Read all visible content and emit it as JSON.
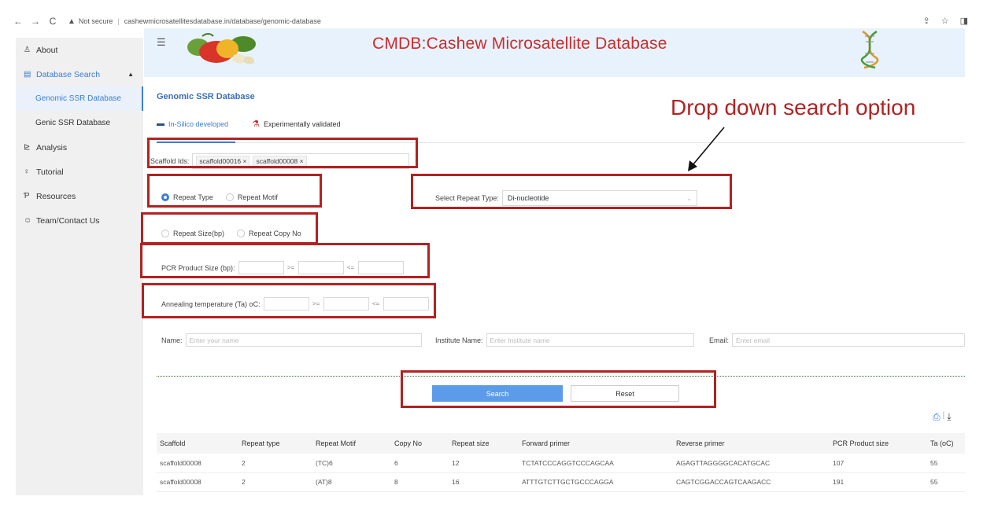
{
  "browser": {
    "back": "←",
    "forward": "→",
    "reload": "C",
    "security": "Not secure",
    "url": "cashewmicrosatellitesdatabase.in/database/genomic-database"
  },
  "sidebar": {
    "items": [
      {
        "label": "About",
        "icon": "person-icon"
      },
      {
        "label": "Database Search",
        "icon": "database-icon"
      },
      {
        "label": "Genomic SSR Database"
      },
      {
        "label": "Genic SSR Database"
      },
      {
        "label": "Analysis",
        "icon": "chart-icon"
      },
      {
        "label": "Tutorial",
        "icon": "bulb-icon"
      },
      {
        "label": "Resources",
        "icon": "resources-icon"
      },
      {
        "label": "Team/Contact Us",
        "icon": "contact-icon"
      }
    ]
  },
  "header": {
    "title": "CMDB:Cashew Microsatellite Database"
  },
  "page": {
    "title": "Genomic SSR Database",
    "tabs": [
      {
        "label": "In-Silico developed"
      },
      {
        "label": "Experimentally validated"
      }
    ]
  },
  "form": {
    "scaffold_label": "Scaffold Ids:",
    "scaffold_tags": [
      "scaffold00016 ×",
      "scaffold00008 ×"
    ],
    "repeat_type_label": "Repeat Type",
    "repeat_motif_label": "Repeat Motif",
    "select_repeat_label": "Select Repeat Type:",
    "select_repeat_value": "Di-nucleotide",
    "repeat_size_label": "Repeat Size(bp)",
    "repeat_copy_label": "Repeat Copy No",
    "pcr_label": "PCR Product Size (bp):",
    "ta_label": "Annealing temperature (Ta) oC:",
    "op_gte": ">=",
    "op_lte": "<=",
    "name_label": "Name:",
    "name_placeholder": "Enter your name",
    "institute_label": "Institute Name:",
    "institute_placeholder": "Enter Institute name",
    "email_label": "Email:",
    "email_placeholder": "Enter email",
    "search_button": "Search",
    "reset_button": "Reset"
  },
  "table": {
    "headers": [
      "Scaffold",
      "Repeat type",
      "Repeat Motif",
      "Copy No",
      "Repeat size",
      "Forward primer",
      "Reverse primer",
      "PCR Product size",
      "Ta (oC)"
    ],
    "rows": [
      [
        "scaffold00008",
        "2",
        "(TC)6",
        "6",
        "12",
        "TCTATCCCAGGTCCCAGCAA",
        "AGAGTTAGGGGCACATGCAC",
        "107",
        "55"
      ],
      [
        "scaffold00008",
        "2",
        "(AT)8",
        "8",
        "16",
        "ATTTGTCTTGCTGCCCAGGA",
        "CAGTCGGACCAGTCAAGACC",
        "191",
        "55"
      ]
    ]
  },
  "annotation": {
    "text": "Drop down search option"
  },
  "colors": {
    "accent": "#3b7ed6",
    "title_red": "#cc2b2b",
    "annotation_red": "#b22222"
  }
}
